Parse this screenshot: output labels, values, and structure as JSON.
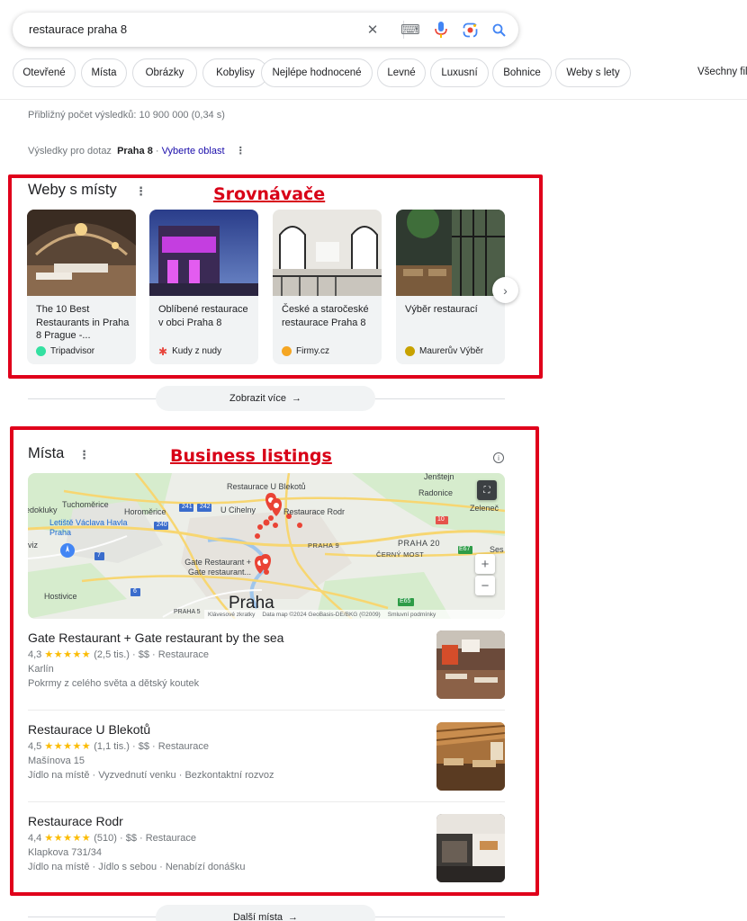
{
  "search": {
    "query": "restaurace praha 8"
  },
  "chips": [
    {
      "label": "Otevřené"
    },
    {
      "label": "Místa"
    },
    {
      "label": "Obrázky"
    },
    {
      "label": "Kobylisy"
    },
    {
      "label": "Nejlépe hodnocené"
    },
    {
      "label": "Levné"
    },
    {
      "label": "Luxusní"
    },
    {
      "label": "Bohnice"
    },
    {
      "label": "Weby s lety"
    }
  ],
  "chip_all": "Všechny fil",
  "stats": "Přibližný počet výsledků: 10 900 000 (0,34 s)",
  "results_for": {
    "prefix": "Výsledky pro dotaz",
    "place": "Praha 8",
    "sep": "·",
    "choose": "Vyberte oblast"
  },
  "sites_section": {
    "title": "Weby s místy",
    "annotation": "Srovnávače",
    "cards": [
      {
        "title": "The 10 Best Restaurants in Praha 8 Prague -...",
        "source": "Tripadvisor",
        "favicon_color": "#34e0a1"
      },
      {
        "title": "Oblíbené restaurace v obci Praha 8",
        "source": "Kudy z nudy",
        "favicon_color": "#e8453c"
      },
      {
        "title": "České a staročeské restaurace Praha 8",
        "source": "Firmy.cz",
        "favicon_color": "#f5a623"
      },
      {
        "title": "Výběr restaurací",
        "source": "Maurerův Výběr",
        "favicon_color": "#c8a200"
      }
    ],
    "more_label": "Zobrazit více"
  },
  "places_section": {
    "title": "Místa",
    "annotation": "Business listings",
    "map": {
      "labels": {
        "u_blekotu": "Restaurace U Blekotů",
        "tuchomerice": "Tuchoměrice",
        "horomerice": "Horoměrice",
        "u_cihelny": "U Cihelny",
        "rodr": "Restaurace Rodr",
        "jenstejn": "Jenštejn",
        "radonice": "Radonice",
        "zeleneč": "Zeleneč",
        "letiste": "Letiště Václava Havla Praha",
        "dokluky": "edokluky",
        "praha9": "PRAHA 9",
        "praha20": "PRAHA 20",
        "cerny_most": "ČERNÝ MOST",
        "gate": "Gate Restaurant + Gate restaurant...",
        "hostivice": "Hostivice",
        "praha": "Praha",
        "praha5": "PRAHA 5",
        "viz": "viz",
        "ses": "Ses",
        "road_241": "241",
        "road_242": "242",
        "road_240": "240",
        "road_10": "10",
        "road_7": "7",
        "road_6": "6",
        "road_e67": "E67",
        "road_e65": "E65"
      },
      "footer": [
        "Klávesové zkratky",
        "Data map ©2024 GeoBasis-DE/BKG (©2009)",
        "Smluvní podmínky"
      ],
      "zoom_in": "+",
      "zoom_out": "−"
    },
    "listings": [
      {
        "name": "Gate Restaurant + Gate restaurant by the sea",
        "rating": "4,3",
        "stars": "★★★★★",
        "reviews": "(2,5 tis.)",
        "price": "$$",
        "category": "Restaurace",
        "address": "Karlín",
        "details": "Pokrmy z celého světa a dětský koutek"
      },
      {
        "name": "Restaurace U Blekotů",
        "rating": "4,5",
        "stars": "★★★★★",
        "reviews": "(1,1 tis.)",
        "price": "$$",
        "category": "Restaurace",
        "address": "Mašínova 15",
        "details": "Jídlo na místě · Vyzvednutí venku · Bezkontaktní rozvoz"
      },
      {
        "name": "Restaurace Rodr",
        "rating": "4,4",
        "stars": "★★★★★",
        "reviews": "(510)",
        "price": "$$",
        "category": "Restaurace",
        "address": "Klapkova 731/34",
        "details": "Jídlo na místě · Jídlo s sebou · Nenabízí donášku"
      }
    ],
    "more_label": "Další místa"
  },
  "icons": {
    "clear": "✕",
    "keyboard": "⌨",
    "arrow": "→",
    "chevron": "›",
    "dots": "⋮",
    "info": "i"
  }
}
